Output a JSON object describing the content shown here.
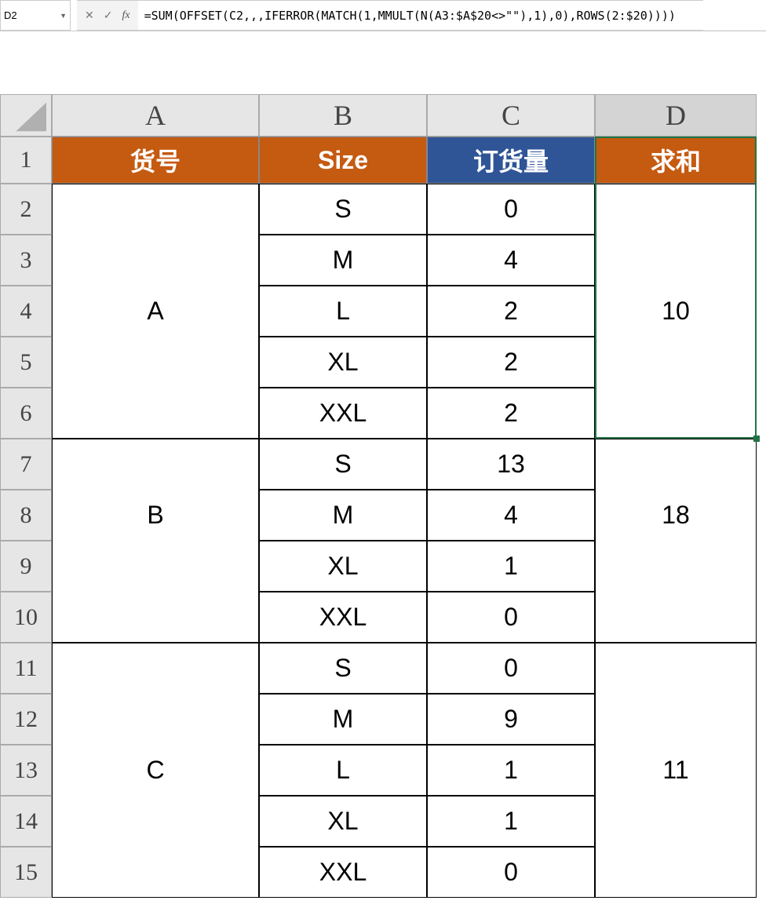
{
  "formula_bar": {
    "cell_ref": "D2",
    "formula": "=SUM(OFFSET(C2,,,IFERROR(MATCH(1,MMULT(N(A3:$A$20<>\"\"),1),0),ROWS(2:$20))))"
  },
  "column_letters": [
    "A",
    "B",
    "C",
    "D"
  ],
  "row_numbers": [
    "1",
    "2",
    "3",
    "4",
    "5",
    "6",
    "7",
    "8",
    "9",
    "10",
    "11",
    "12",
    "13",
    "14",
    "15"
  ],
  "headers": {
    "A": "货号",
    "B": "Size",
    "C": "订货量",
    "D": "求和"
  },
  "groups": [
    {
      "code": "A",
      "sum": "10",
      "rows": [
        {
          "size": "S",
          "qty": "0"
        },
        {
          "size": "M",
          "qty": "4"
        },
        {
          "size": "L",
          "qty": "2"
        },
        {
          "size": "XL",
          "qty": "2"
        },
        {
          "size": "XXL",
          "qty": "2"
        }
      ]
    },
    {
      "code": "B",
      "sum": "18",
      "rows": [
        {
          "size": "S",
          "qty": "13"
        },
        {
          "size": "M",
          "qty": "4"
        },
        {
          "size": "XL",
          "qty": "1"
        },
        {
          "size": "XXL",
          "qty": "0"
        }
      ]
    },
    {
      "code": "C",
      "sum": "11",
      "rows": [
        {
          "size": "S",
          "qty": "0"
        },
        {
          "size": "M",
          "qty": "9"
        },
        {
          "size": "L",
          "qty": "1"
        },
        {
          "size": "XL",
          "qty": "1"
        },
        {
          "size": "XXL",
          "qty": "0"
        }
      ]
    }
  ],
  "active_cell": "D2",
  "active_column": "D"
}
